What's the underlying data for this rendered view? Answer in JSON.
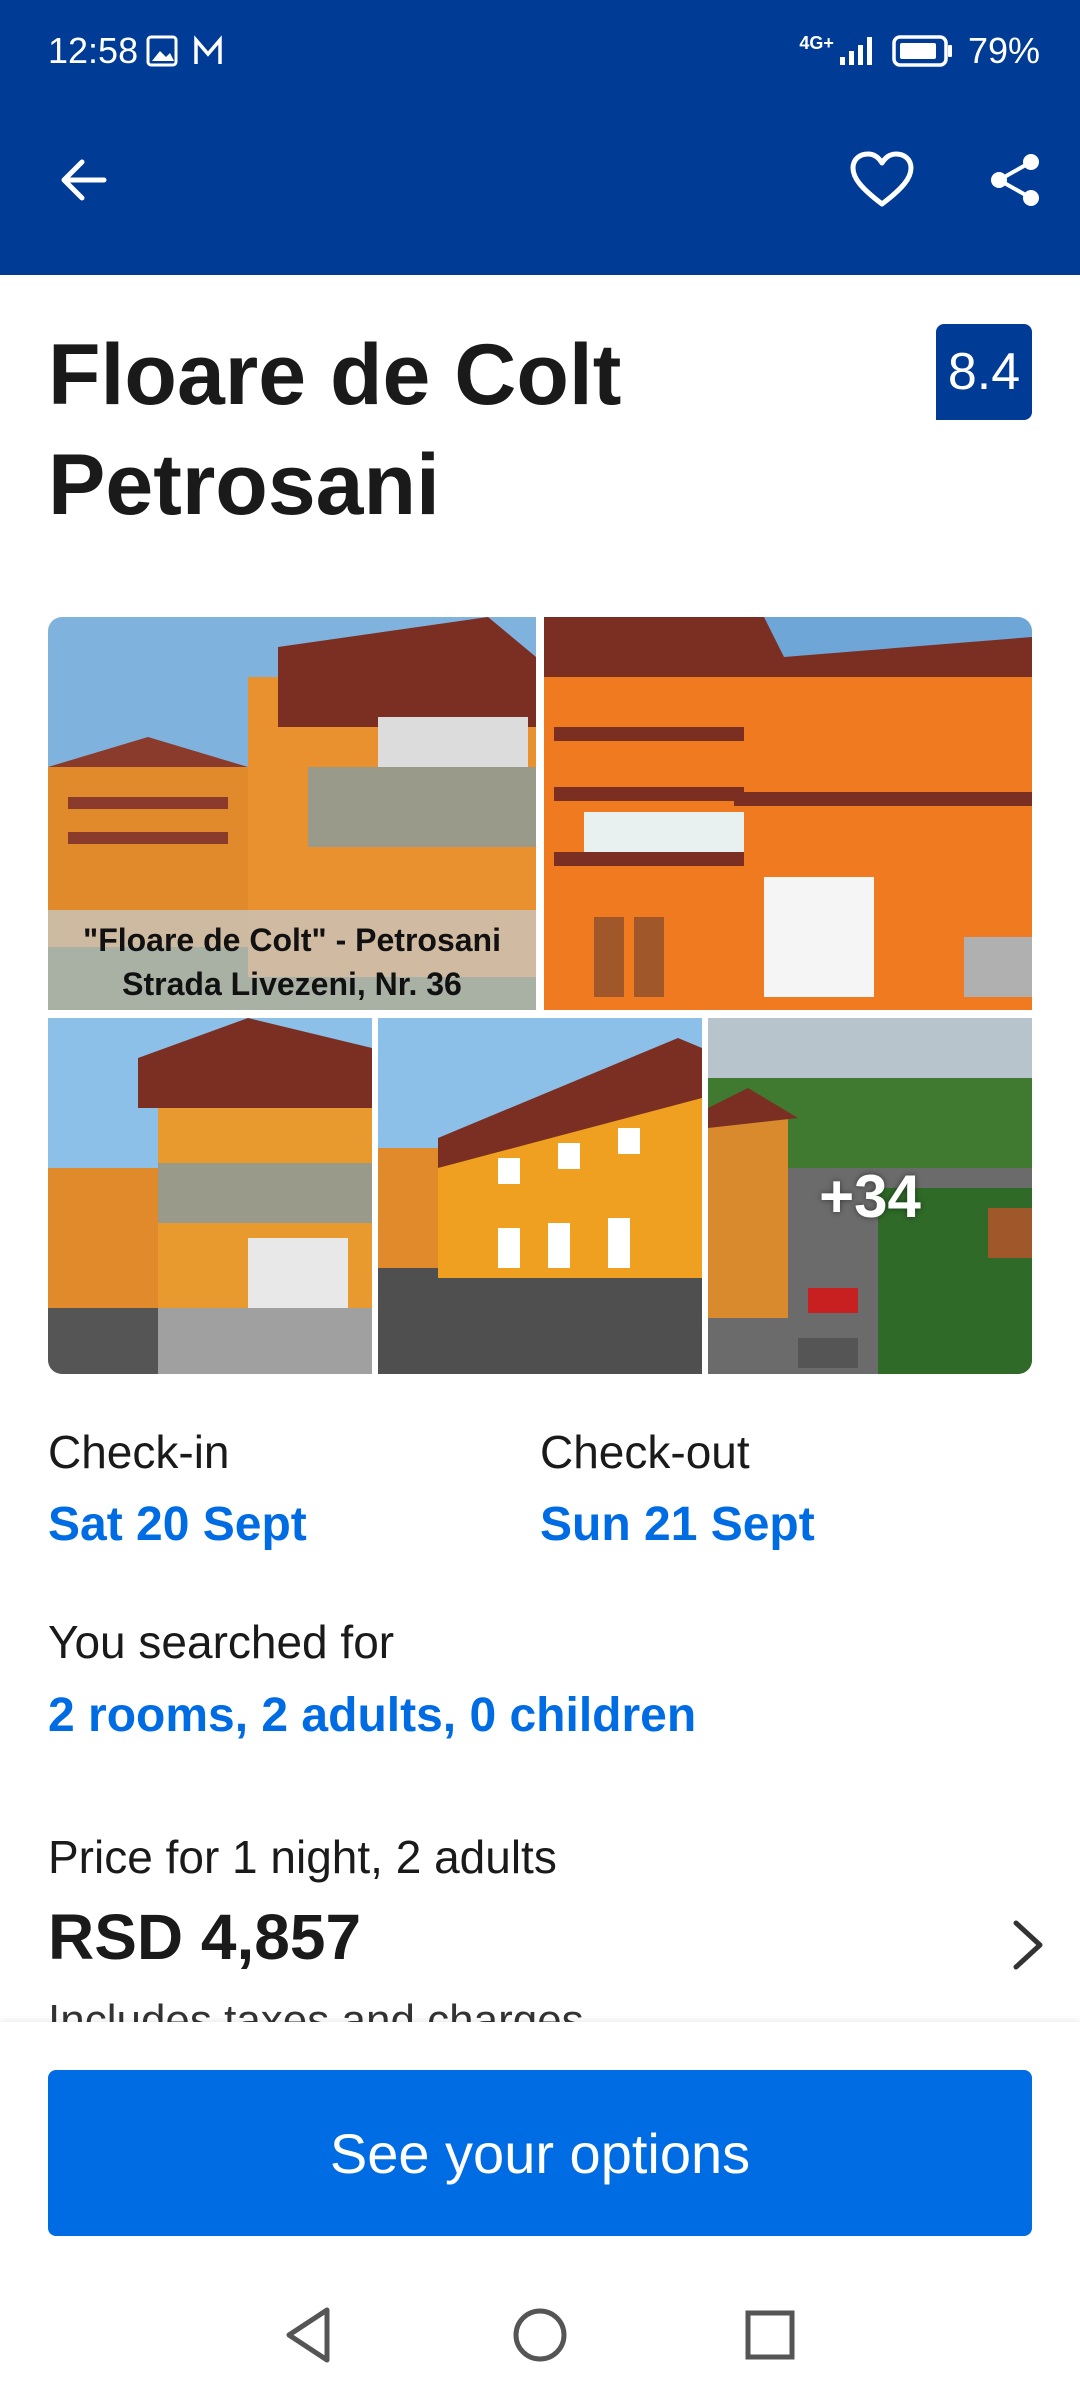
{
  "status_bar": {
    "time": "12:58",
    "network": "4G+",
    "battery": "79%"
  },
  "header": {
    "back_icon": "arrow-left-icon",
    "favorite_icon": "heart-icon",
    "share_icon": "share-icon",
    "background": "#003b95"
  },
  "property": {
    "title_line1": "Floare de Colt",
    "title_line2": "Petrosani",
    "score": "8.4"
  },
  "gallery": {
    "photo1_caption_line1": "\"Floare de Colt\" - Petrosani",
    "photo1_caption_line2": "Strada Livezeni, Nr. 36",
    "more_count": "+34"
  },
  "dates": {
    "checkin_label": "Check-in",
    "checkin_value": "Sat 20 Sept",
    "checkout_label": "Check-out",
    "checkout_value": "Sun 21 Sept"
  },
  "search": {
    "label": "You searched for",
    "value": "2 rooms, 2 adults, 0 children"
  },
  "pricing": {
    "label": "Price for 1 night, 2 adults",
    "amount": "RSD 4,857",
    "note": "Includes taxes and charges"
  },
  "cta": {
    "label": "See your options",
    "color": "#006ce4"
  },
  "system_nav": {
    "back_icon": "triangle-back-icon",
    "home_icon": "circle-home-icon",
    "recents_icon": "square-recents-icon"
  }
}
